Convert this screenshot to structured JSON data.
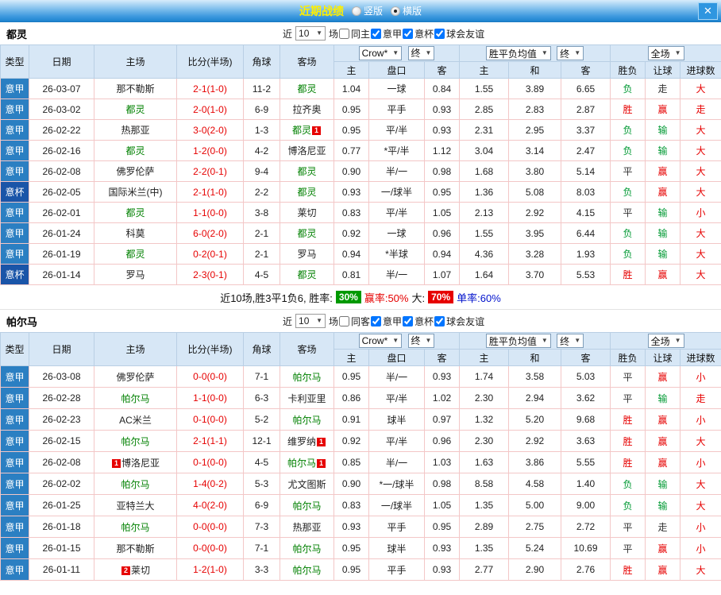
{
  "header": {
    "title": "近期战绩",
    "radios": [
      {
        "label": "竖版",
        "selected": false
      },
      {
        "label": "横版",
        "selected": true
      }
    ]
  },
  "icons": {
    "close": "✕",
    "caret": "▼"
  },
  "filters": {
    "near": "近",
    "games_count": "10",
    "games_suffix": "场",
    "leagues": [
      "意甲",
      "意杯",
      "球会友谊"
    ]
  },
  "selects": {
    "bookmaker": "Crow*",
    "final": "终",
    "avg": "胜平负均值",
    "fulltime": "全场"
  },
  "columns": {
    "type": "类型",
    "date": "日期",
    "home": "主场",
    "score": "比分(半场)",
    "corner": "角球",
    "away": "客场",
    "odds_home": "主",
    "odds_line": "盘口",
    "odds_away": "客",
    "eu_home": "主",
    "eu_draw": "和",
    "eu_away": "客",
    "result": "胜负",
    "handicap": "让球",
    "goals": "进球数"
  },
  "colors": {
    "league_bg": "#2b7fc2",
    "cup_bg": "#1a55a8",
    "focus_team": "#008000",
    "score": "#e60000",
    "result": {
      "胜": "#e60000",
      "平": "#333333",
      "负": "#009933"
    },
    "handicap": {
      "赢": "#e60000",
      "输": "#009933",
      "走": "#333333"
    },
    "goals": {
      "大": "#e60000",
      "小": "#e60000",
      "走": "#e60000"
    },
    "badge_green": "#009900",
    "badge_red": "#e60000"
  },
  "sections": [
    {
      "team": "都灵",
      "same_label": "同主",
      "rows": [
        {
          "league": "意甲",
          "date": "26-03-07",
          "home": "那不勒斯",
          "score": "2-1(1-0)",
          "corner": "11-2",
          "away": "都灵",
          "away_focus": true,
          "ah": [
            "1.04",
            "一球",
            "0.84"
          ],
          "eu": [
            "1.55",
            "3.89",
            "6.65"
          ],
          "result": "负",
          "handicap": "走",
          "goals": "大"
        },
        {
          "league": "意甲",
          "date": "26-03-02",
          "home": "都灵",
          "home_focus": true,
          "score": "2-0(1-0)",
          "corner": "6-9",
          "away": "拉齐奥",
          "ah": [
            "0.95",
            "平手",
            "0.93"
          ],
          "eu": [
            "2.85",
            "2.83",
            "2.87"
          ],
          "result": "胜",
          "handicap": "赢",
          "goals": "走"
        },
        {
          "league": "意甲",
          "date": "26-02-22",
          "home": "热那亚",
          "score": "3-0(2-0)",
          "corner": "1-3",
          "away": "都灵",
          "away_focus": true,
          "away_red": "1",
          "ah": [
            "0.95",
            "平/半",
            "0.93"
          ],
          "eu": [
            "2.31",
            "2.95",
            "3.37"
          ],
          "result": "负",
          "handicap": "输",
          "goals": "大"
        },
        {
          "league": "意甲",
          "date": "26-02-16",
          "home": "都灵",
          "home_focus": true,
          "score": "1-2(0-0)",
          "corner": "4-2",
          "away": "博洛尼亚",
          "ah": [
            "0.77",
            "*平/半",
            "1.12"
          ],
          "eu": [
            "3.04",
            "3.14",
            "2.47"
          ],
          "result": "负",
          "handicap": "输",
          "goals": "大"
        },
        {
          "league": "意甲",
          "date": "26-02-08",
          "home": "佛罗伦萨",
          "score": "2-2(0-1)",
          "corner": "9-4",
          "away": "都灵",
          "away_focus": true,
          "ah": [
            "0.90",
            "半/一",
            "0.98"
          ],
          "eu": [
            "1.68",
            "3.80",
            "5.14"
          ],
          "result": "平",
          "handicap": "赢",
          "goals": "大"
        },
        {
          "league": "意杯",
          "cup": true,
          "date": "26-02-05",
          "home": "国际米兰(中)",
          "score": "2-1(1-0)",
          "corner": "2-2",
          "away": "都灵",
          "away_focus": true,
          "ah": [
            "0.93",
            "一/球半",
            "0.95"
          ],
          "eu": [
            "1.36",
            "5.08",
            "8.03"
          ],
          "result": "负",
          "handicap": "赢",
          "goals": "大"
        },
        {
          "league": "意甲",
          "date": "26-02-01",
          "home": "都灵",
          "home_focus": true,
          "score": "1-1(0-0)",
          "corner": "3-8",
          "away": "莱切",
          "ah": [
            "0.83",
            "平/半",
            "1.05"
          ],
          "eu": [
            "2.13",
            "2.92",
            "4.15"
          ],
          "result": "平",
          "handicap": "输",
          "goals": "小"
        },
        {
          "league": "意甲",
          "date": "26-01-24",
          "home": "科莫",
          "score": "6-0(2-0)",
          "corner": "2-1",
          "away": "都灵",
          "away_focus": true,
          "ah": [
            "0.92",
            "一球",
            "0.96"
          ],
          "eu": [
            "1.55",
            "3.95",
            "6.44"
          ],
          "result": "负",
          "handicap": "输",
          "goals": "大"
        },
        {
          "league": "意甲",
          "date": "26-01-19",
          "home": "都灵",
          "home_focus": true,
          "score": "0-2(0-1)",
          "corner": "2-1",
          "away": "罗马",
          "ah": [
            "0.94",
            "*半球",
            "0.94"
          ],
          "eu": [
            "4.36",
            "3.28",
            "1.93"
          ],
          "result": "负",
          "handicap": "输",
          "goals": "大"
        },
        {
          "league": "意杯",
          "cup": true,
          "date": "26-01-14",
          "home": "罗马",
          "score": "2-3(0-1)",
          "corner": "4-5",
          "away": "都灵",
          "away_focus": true,
          "ah": [
            "0.81",
            "半/一",
            "1.07"
          ],
          "eu": [
            "1.64",
            "3.70",
            "5.53"
          ],
          "result": "胜",
          "handicap": "赢",
          "goals": "大"
        }
      ],
      "summary": {
        "text1": "近10场,胜3平1负6, 胜率:",
        "badge1": "30%",
        "text2": "赢率:50%",
        "text3": "大:",
        "badge2": "70%",
        "text4": "单率:60%"
      }
    },
    {
      "team": "帕尔马",
      "same_label": "同客",
      "rows": [
        {
          "league": "意甲",
          "date": "26-03-08",
          "home": "佛罗伦萨",
          "score": "0-0(0-0)",
          "corner": "7-1",
          "away": "帕尔马",
          "away_focus": true,
          "ah": [
            "0.95",
            "半/一",
            "0.93"
          ],
          "eu": [
            "1.74",
            "3.58",
            "5.03"
          ],
          "result": "平",
          "handicap": "赢",
          "goals": "小"
        },
        {
          "league": "意甲",
          "date": "26-02-28",
          "home": "帕尔马",
          "home_focus": true,
          "score": "1-1(0-0)",
          "corner": "6-3",
          "away": "卡利亚里",
          "ah": [
            "0.86",
            "平/半",
            "1.02"
          ],
          "eu": [
            "2.30",
            "2.94",
            "3.62"
          ],
          "result": "平",
          "handicap": "输",
          "goals": "走"
        },
        {
          "league": "意甲",
          "date": "26-02-23",
          "home": "AC米兰",
          "score": "0-1(0-0)",
          "corner": "5-2",
          "away": "帕尔马",
          "away_focus": true,
          "ah": [
            "0.91",
            "球半",
            "0.97"
          ],
          "eu": [
            "1.32",
            "5.20",
            "9.68"
          ],
          "result": "胜",
          "handicap": "赢",
          "goals": "小"
        },
        {
          "league": "意甲",
          "date": "26-02-15",
          "home": "帕尔马",
          "home_focus": true,
          "score": "2-1(1-1)",
          "corner": "12-1",
          "away": "维罗纳",
          "away_red": "1",
          "ah": [
            "0.92",
            "平/半",
            "0.96"
          ],
          "eu": [
            "2.30",
            "2.92",
            "3.63"
          ],
          "result": "胜",
          "handicap": "赢",
          "goals": "大"
        },
        {
          "league": "意甲",
          "date": "26-02-08",
          "home": "博洛尼亚",
          "home_red": "1",
          "score": "0-1(0-0)",
          "corner": "4-5",
          "away": "帕尔马",
          "away_focus": true,
          "away_red": "1",
          "ah": [
            "0.85",
            "半/一",
            "1.03"
          ],
          "eu": [
            "1.63",
            "3.86",
            "5.55"
          ],
          "result": "胜",
          "handicap": "赢",
          "goals": "小"
        },
        {
          "league": "意甲",
          "date": "26-02-02",
          "home": "帕尔马",
          "home_focus": true,
          "score": "1-4(0-2)",
          "corner": "5-3",
          "away": "尤文图斯",
          "ah": [
            "0.90",
            "*一/球半",
            "0.98"
          ],
          "eu": [
            "8.58",
            "4.58",
            "1.40"
          ],
          "result": "负",
          "handicap": "输",
          "goals": "大"
        },
        {
          "league": "意甲",
          "date": "26-01-25",
          "home": "亚特兰大",
          "score": "4-0(2-0)",
          "corner": "6-9",
          "away": "帕尔马",
          "away_focus": true,
          "ah": [
            "0.83",
            "一/球半",
            "1.05"
          ],
          "eu": [
            "1.35",
            "5.00",
            "9.00"
          ],
          "result": "负",
          "handicap": "输",
          "goals": "大"
        },
        {
          "league": "意甲",
          "date": "26-01-18",
          "home": "帕尔马",
          "home_focus": true,
          "score": "0-0(0-0)",
          "corner": "7-3",
          "away": "热那亚",
          "ah": [
            "0.93",
            "平手",
            "0.95"
          ],
          "eu": [
            "2.89",
            "2.75",
            "2.72"
          ],
          "result": "平",
          "handicap": "走",
          "goals": "小"
        },
        {
          "league": "意甲",
          "date": "26-01-15",
          "home": "那不勒斯",
          "score": "0-0(0-0)",
          "corner": "7-1",
          "away": "帕尔马",
          "away_focus": true,
          "ah": [
            "0.95",
            "球半",
            "0.93"
          ],
          "eu": [
            "1.35",
            "5.24",
            "10.69"
          ],
          "result": "平",
          "handicap": "赢",
          "goals": "小"
        },
        {
          "league": "意甲",
          "date": "26-01-11",
          "home": "莱切",
          "home_red": "2",
          "score": "1-2(1-0)",
          "corner": "3-3",
          "away": "帕尔马",
          "away_focus": true,
          "ah": [
            "0.95",
            "平手",
            "0.93"
          ],
          "eu": [
            "2.77",
            "2.90",
            "2.76"
          ],
          "result": "胜",
          "handicap": "赢",
          "goals": "大"
        }
      ]
    }
  ]
}
